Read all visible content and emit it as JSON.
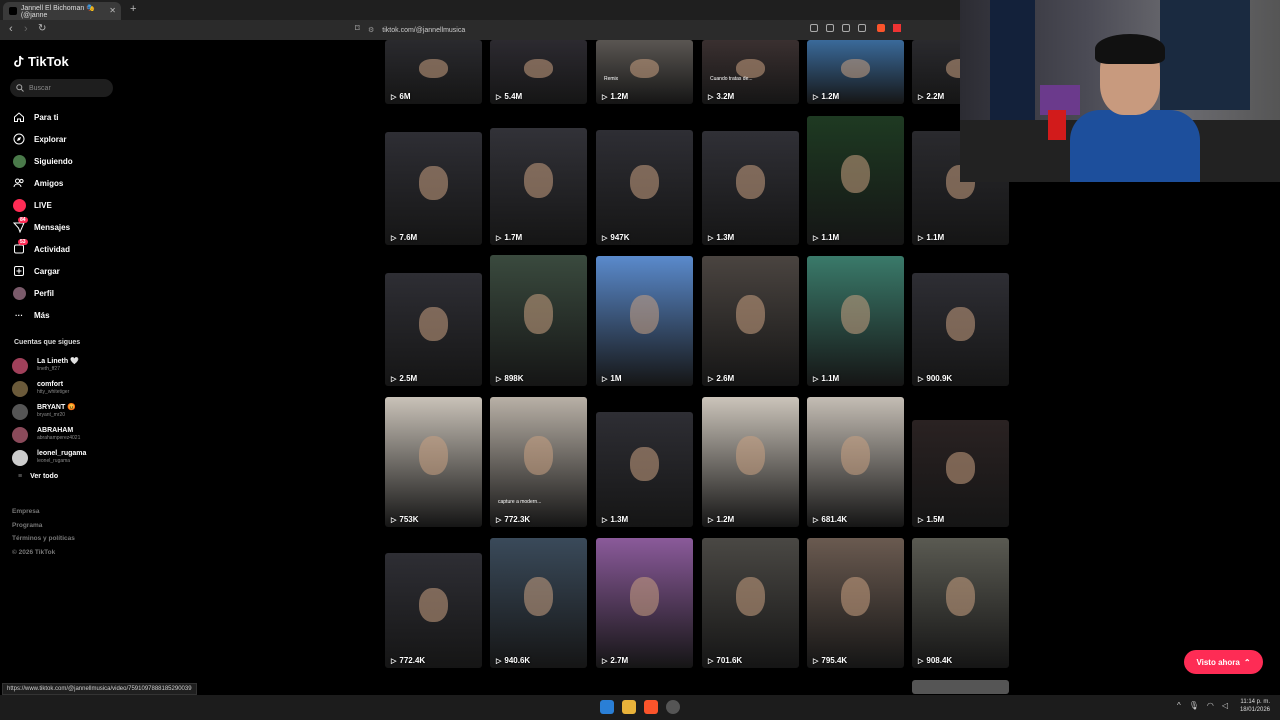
{
  "browser": {
    "tab_title": "Jannell El Bichoman 🎭 (@janne",
    "url": "tiktok.com/@jannellmusica",
    "status_url": "https://www.tiktok.com/@jannellmusica/video/7591097888185290039"
  },
  "sidebar": {
    "logo": "TikTok",
    "search_placeholder": "Buscar",
    "nav": [
      {
        "label": "Para ti",
        "icon": "home-icon",
        "badge": ""
      },
      {
        "label": "Explorar",
        "icon": "compass-icon",
        "badge": ""
      },
      {
        "label": "Siguiendo",
        "icon": "following-avatar-icon",
        "badge": ""
      },
      {
        "label": "Amigos",
        "icon": "friends-icon",
        "badge": ""
      },
      {
        "label": "LIVE",
        "icon": "live-icon",
        "badge": ""
      },
      {
        "label": "Mensajes",
        "icon": "messages-icon",
        "badge": "84"
      },
      {
        "label": "Actividad",
        "icon": "activity-icon",
        "badge": "53"
      },
      {
        "label": "Cargar",
        "icon": "upload-icon",
        "badge": ""
      },
      {
        "label": "Perfil",
        "icon": "profile-icon",
        "badge": ""
      },
      {
        "label": "Más",
        "icon": "more-icon",
        "badge": ""
      }
    ],
    "following_title": "Cuentas que sigues",
    "following": [
      {
        "name": "La Lineth 🤍",
        "handle": "lineth_ff27",
        "color": "#a0405a"
      },
      {
        "name": "comfort",
        "handle": "htty_whitetiger",
        "color": "#6b5a3a"
      },
      {
        "name": "BRYANT 😡",
        "handle": "bryant_mr20",
        "color": "#555555"
      },
      {
        "name": "ABRAHAM",
        "handle": "abrahamperez4021",
        "color": "#8a4a5a"
      },
      {
        "name": "leonel_rugama",
        "handle": "leonel_rugama",
        "color": "#cccccc"
      }
    ],
    "see_all": "Ver todo",
    "footer": [
      "Empresa",
      "Programa",
      "Términos y políticas",
      "© 2026 TikTok"
    ]
  },
  "videos": [
    {
      "views": "6M",
      "bg": "#2a2a2e",
      "overlay": ""
    },
    {
      "views": "5.4M",
      "bg": "#2c2a30",
      "overlay": ""
    },
    {
      "views": "1.2M",
      "bg": "#5a5652",
      "overlay": "Remix"
    },
    {
      "views": "3.2M",
      "bg": "#3a3030",
      "overlay": "Cuando tratas de..."
    },
    {
      "views": "1.2M",
      "bg": "#3a6a9a",
      "overlay": ""
    },
    {
      "views": "2.2M",
      "bg": "#2a2a2e",
      "overlay": ""
    },
    {
      "views": "7.6M",
      "bg": "#2e2e34",
      "overlay": ""
    },
    {
      "views": "1.7M",
      "bg": "#323238",
      "overlay": ""
    },
    {
      "views": "947K",
      "bg": "#2e2e34",
      "overlay": ""
    },
    {
      "views": "1.3M",
      "bg": "#303036",
      "overlay": ""
    },
    {
      "views": "1.1M",
      "bg": "#1e3a22",
      "overlay": ""
    },
    {
      "views": "1.1M",
      "bg": "#2a2a2e",
      "overlay": ""
    },
    {
      "views": "2.5M",
      "bg": "#2e2e34",
      "overlay": ""
    },
    {
      "views": "898K",
      "bg": "#3a4a3e",
      "overlay": ""
    },
    {
      "views": "1M",
      "bg": "#5a8acc",
      "overlay": ""
    },
    {
      "views": "2.6M",
      "bg": "#4a4440",
      "overlay": ""
    },
    {
      "views": "1.1M",
      "bg": "#3a7a6a",
      "overlay": ""
    },
    {
      "views": "900.9K",
      "bg": "#2e2e34",
      "overlay": ""
    },
    {
      "views": "753K",
      "bg": "#c9c2b8",
      "overlay": ""
    },
    {
      "views": "772.3K",
      "bg": "#b8b0a6",
      "overlay": "capture a modern..."
    },
    {
      "views": "1.3M",
      "bg": "#2e2e34",
      "overlay": ""
    },
    {
      "views": "1.2M",
      "bg": "#cbc4ba",
      "overlay": ""
    },
    {
      "views": "681.4K",
      "bg": "#c4bdb4",
      "overlay": ""
    },
    {
      "views": "1.5M",
      "bg": "#2a2222",
      "overlay": ""
    },
    {
      "views": "772.4K",
      "bg": "#2e2e34",
      "overlay": ""
    },
    {
      "views": "940.6K",
      "bg": "#3a4a5a",
      "overlay": ""
    },
    {
      "views": "2.7M",
      "bg": "#8a5a9a",
      "overlay": ""
    },
    {
      "views": "701.6K",
      "bg": "#4a4844",
      "overlay": ""
    },
    {
      "views": "795.4K",
      "bg": "#6a5a50",
      "overlay": ""
    },
    {
      "views": "908.4K",
      "bg": "#5a5a52",
      "overlay": ""
    }
  ],
  "visto_ahora": "Visto ahora",
  "taskbar": {
    "time": "11:14 p. m.",
    "date": "18/01/2026"
  }
}
